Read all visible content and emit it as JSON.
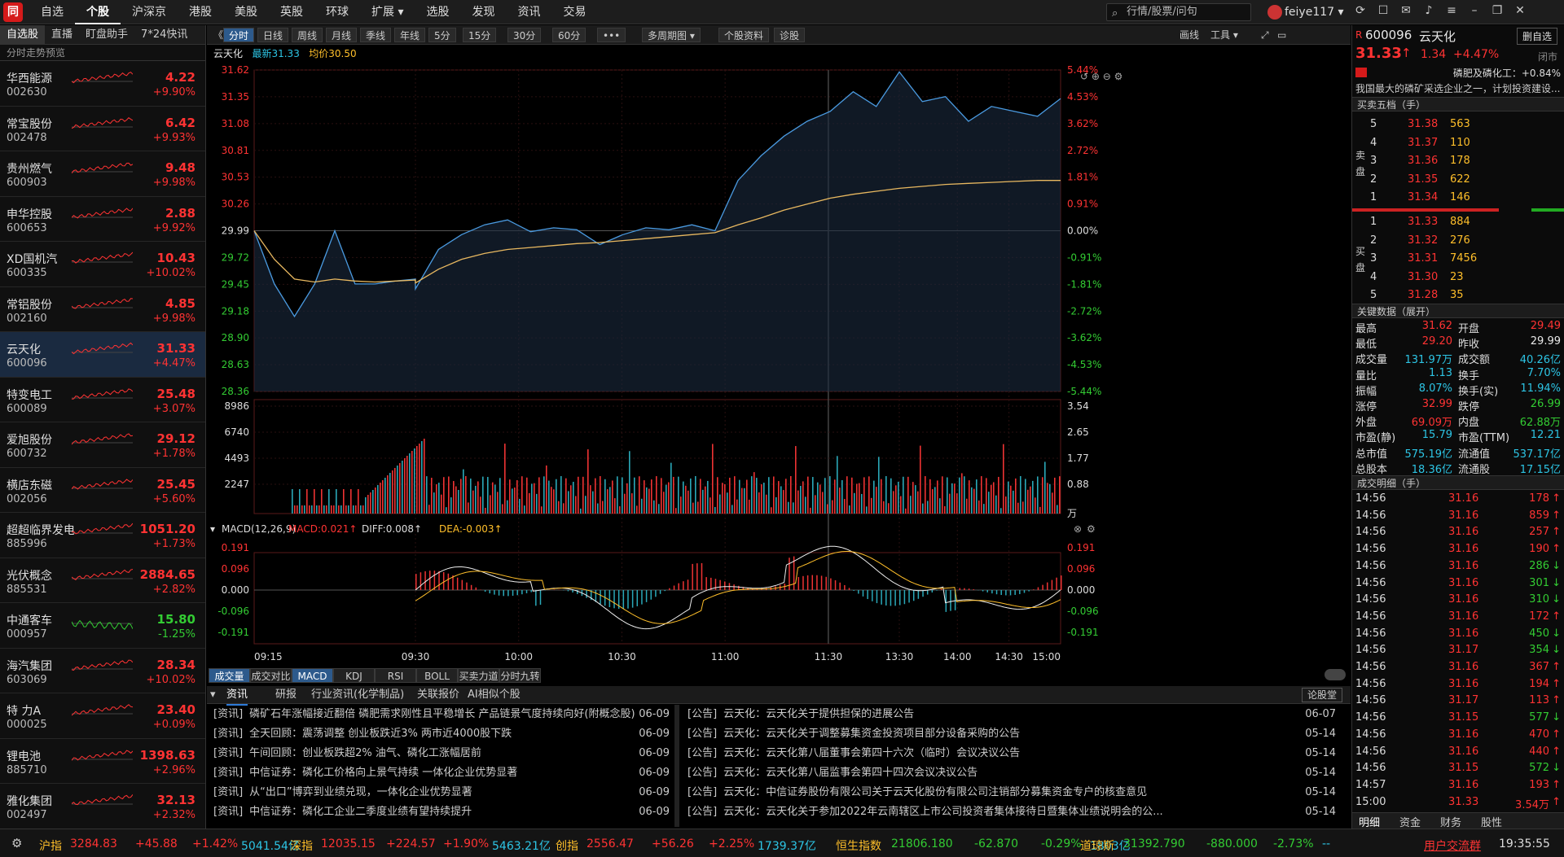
{
  "menu": [
    "自选",
    "个股",
    "沪深京",
    "港股",
    "美股",
    "英股",
    "环球",
    "扩展 ▾",
    "选股",
    "发现",
    "资讯",
    "交易"
  ],
  "search_placeholder": "行情/股票/问句",
  "user": "feiye117",
  "left_tabs": [
    "自选股",
    "直播",
    "盯盘助手",
    "7*24快讯"
  ],
  "left_sub": "分时走势预览",
  "stocks": [
    {
      "name": "华西能源",
      "code": "002630",
      "price": "4.22",
      "chg": "+9.90%",
      "up": true
    },
    {
      "name": "常宝股份",
      "code": "002478",
      "price": "6.42",
      "chg": "+9.93%",
      "up": true
    },
    {
      "name": "贵州燃气",
      "code": "600903",
      "price": "9.48",
      "chg": "+9.98%",
      "up": true
    },
    {
      "name": "申华控股",
      "code": "600653",
      "price": "2.88",
      "chg": "+9.92%",
      "up": true
    },
    {
      "name": "XD国机汽",
      "code": "600335",
      "price": "10.43",
      "chg": "+10.02%",
      "up": true
    },
    {
      "name": "常铝股份",
      "code": "002160",
      "price": "4.85",
      "chg": "+9.98%",
      "up": true
    },
    {
      "name": "云天化",
      "code": "600096",
      "price": "31.33",
      "chg": "+4.47%",
      "up": true
    },
    {
      "name": "特变电工",
      "code": "600089",
      "price": "25.48",
      "chg": "+3.07%",
      "up": true
    },
    {
      "name": "爱旭股份",
      "code": "600732",
      "price": "29.12",
      "chg": "+1.78%",
      "up": true
    },
    {
      "name": "横店东磁",
      "code": "002056",
      "price": "25.45",
      "chg": "+5.60%",
      "up": true
    },
    {
      "name": "超超临界发电",
      "code": "885996",
      "price": "1051.20",
      "chg": "+1.73%",
      "up": true
    },
    {
      "name": "光伏概念",
      "code": "885531",
      "price": "2884.65",
      "chg": "+2.82%",
      "up": true
    },
    {
      "name": "中通客车",
      "code": "000957",
      "price": "15.80",
      "chg": "-1.25%",
      "up": false
    },
    {
      "name": "海汽集团",
      "code": "603069",
      "price": "28.34",
      "chg": "+10.02%",
      "up": true
    },
    {
      "name": "特 力A",
      "code": "000025",
      "price": "23.40",
      "chg": "+0.09%",
      "up": true
    },
    {
      "name": "锂电池",
      "code": "885710",
      "price": "1398.63",
      "chg": "+2.96%",
      "up": true
    },
    {
      "name": "雅化集团",
      "code": "002497",
      "price": "32.13",
      "chg": "+2.32%",
      "up": true
    }
  ],
  "toolbar": {
    "items": [
      "分时",
      "日线",
      "周线",
      "月线",
      "季线",
      "年线",
      "5分",
      "15分",
      "30分",
      "60分",
      "•••",
      "多周期图 ▾",
      "个股资料",
      "诊股"
    ],
    "right": [
      "画线",
      "工具 ▾"
    ]
  },
  "info": {
    "name": "云天化",
    "latest": "最新31.33",
    "avg": "均价30.50"
  },
  "chart_data": [
    {
      "type": "line",
      "title": "分时",
      "series": [
        {
          "name": "最新",
          "color": "#4a9ae0",
          "values": [
            29.99,
            29.45,
            29.12,
            29.45,
            29.99,
            29.45,
            29.45,
            29.48,
            29.5,
            29.4,
            29.8,
            29.95,
            30.05,
            30.1,
            29.98,
            30.02,
            30.0,
            29.85,
            29.95,
            30.02,
            30.0,
            30.05,
            29.99,
            30.5,
            30.75,
            30.95,
            31.1,
            31.2,
            31.4,
            31.25,
            31.6,
            31.3,
            31.35,
            31.1,
            31.25,
            31.2,
            31.15,
            31.33
          ]
        },
        {
          "name": "均价",
          "color": "#e8b860",
          "values": [
            29.99,
            29.7,
            29.5,
            29.47,
            29.5,
            29.48,
            29.47,
            29.48,
            29.49,
            29.46,
            29.6,
            29.7,
            29.76,
            29.8,
            29.82,
            29.84,
            29.86,
            29.87,
            29.89,
            29.91,
            29.93,
            29.95,
            29.97,
            30.05,
            30.12,
            30.2,
            30.26,
            30.32,
            30.36,
            30.39,
            30.42,
            30.44,
            30.46,
            30.47,
            30.48,
            30.49,
            30.5,
            30.5
          ]
        }
      ],
      "ylim": [
        28.36,
        31.62
      ],
      "prev_close": 29.99,
      "y_ticks": [
        "31.62",
        "31.35",
        "31.08",
        "30.81",
        "30.53",
        "30.26",
        "29.99",
        "29.72",
        "29.45",
        "29.18",
        "28.90",
        "28.63",
        "28.36"
      ],
      "pct_ticks": [
        "5.44%",
        "4.53%",
        "3.62%",
        "2.72%",
        "1.81%",
        "0.91%",
        "0.00%",
        "-0.91%",
        "-1.81%",
        "-2.72%",
        "-3.62%",
        "-4.53%",
        "-5.44%"
      ]
    },
    {
      "type": "bar",
      "title": "成交量",
      "y_ticks": [
        "8986",
        "6740",
        "4493",
        "2247"
      ],
      "right_ticks": [
        "3.54",
        "2.65",
        "1.77",
        "0.88"
      ],
      "unit": "万"
    },
    {
      "type": "bar",
      "title": "MACD(12,26,9)",
      "labels": {
        "macd": "MACD:0.021",
        "diff": "DIFF:0.008",
        "dea": "DEA:-0.003"
      },
      "y_ticks": [
        "0.191",
        "0.096",
        "0.000",
        "-0.096",
        "-0.191"
      ]
    }
  ],
  "x_ticks": [
    "09:15",
    "09:30",
    "10:00",
    "10:30",
    "11:00",
    "11:30",
    "13:30",
    "14:00",
    "14:30",
    "15:00"
  ],
  "indicator_tabs": [
    "成交量",
    "成交对比",
    "MACD",
    "KDJ",
    "RSI",
    "BOLL",
    "买卖力道",
    "分时九转"
  ],
  "news_tabs": [
    "资讯",
    "研报",
    "行业资讯(化学制品)",
    "关联报价",
    "AI相似个股"
  ],
  "news_btn": "论股堂",
  "news_left": [
    {
      "tag": "[资讯]",
      "text": "磷矿石年涨幅接近翻倍 磷肥需求刚性且平稳增长 产品链景气度持续向好(附概念股)",
      "date": "06-09"
    },
    {
      "tag": "[资讯]",
      "text": "全天回顾：震荡调整 创业板跌近3% 两市近4000股下跌",
      "date": "06-09"
    },
    {
      "tag": "[资讯]",
      "text": "午间回顾：创业板跌超2% 油气、磷化工涨幅居前",
      "date": "06-09"
    },
    {
      "tag": "[资讯]",
      "text": "中信证券：磷化工价格向上景气持续 一体化企业优势显著",
      "date": "06-09"
    },
    {
      "tag": "[资讯]",
      "text": "从“出口”博弈到业绩兑现，一体化企业优势显著",
      "date": "06-09"
    },
    {
      "tag": "[资讯]",
      "text": "中信证券：磷化工企业二季度业绩有望持续提升",
      "date": "06-09"
    }
  ],
  "news_right": [
    {
      "tag": "[公告]",
      "text": "云天化：云天化关于提供担保的进展公告",
      "date": "06-07"
    },
    {
      "tag": "[公告]",
      "text": "云天化：云天化关于调整募集资金投资项目部分设备采购的公告",
      "date": "05-14"
    },
    {
      "tag": "[公告]",
      "text": "云天化：云天化第八届董事会第四十六次（临时）会议决议公告",
      "date": "05-14"
    },
    {
      "tag": "[公告]",
      "text": "云天化：云天化第八届监事会第四十四次会议决议公告",
      "date": "05-14"
    },
    {
      "tag": "[公告]",
      "text": "云天化：中信证券股份有限公司关于云天化股份有限公司注销部分募集资金专户的核查意见",
      "date": "05-14"
    },
    {
      "tag": "[公告]",
      "text": "云天化：云天化关于参加2022年云南辖区上市公司投资者集体接待日暨集体业绩说明会的公...",
      "date": "05-14"
    }
  ],
  "right": {
    "btn": "删自选",
    "code": "600096",
    "name": "云天化",
    "price": "31.33",
    "chg": "1.34",
    "pct": "+4.47%",
    "state": "闭市",
    "sector": "磷肥及磷化工：+0.84%",
    "desc": "我国最大的磷矿采选企业之一，计划投资建设...",
    "ob_title": "买卖五档（手）",
    "asks": [
      [
        "5",
        "31.38",
        "563"
      ],
      [
        "4",
        "31.37",
        "110"
      ],
      [
        "3",
        "31.36",
        "178"
      ],
      [
        "2",
        "31.35",
        "622"
      ],
      [
        "1",
        "31.34",
        "146"
      ]
    ],
    "bids": [
      [
        "1",
        "31.33",
        "884"
      ],
      [
        "2",
        "31.32",
        "276"
      ],
      [
        "3",
        "31.31",
        "7456"
      ],
      [
        "4",
        "31.30",
        "23"
      ],
      [
        "5",
        "31.28",
        "35"
      ]
    ],
    "ask_label": "卖盘",
    "bid_label": "买盘",
    "key_title": "关键数据（展开）",
    "key": [
      [
        "最高",
        "31.62",
        "red",
        "开盘",
        "29.49",
        "red"
      ],
      [
        "最低",
        "29.20",
        "red",
        "昨收",
        "29.99",
        "white"
      ],
      [
        "成交量",
        "131.97万",
        "cyan",
        "成交额",
        "40.26亿",
        "cyan"
      ],
      [
        "量比",
        "1.13",
        "cyan",
        "换手",
        "7.70%",
        "cyan"
      ],
      [
        "振幅",
        "8.07%",
        "cyan",
        "换手(实)",
        "11.94%",
        "cyan"
      ],
      [
        "涨停",
        "32.99",
        "red",
        "跌停",
        "26.99",
        "green"
      ],
      [
        "外盘",
        "69.09万",
        "red",
        "内盘",
        "62.88万",
        "green"
      ],
      [
        "市盈(静)",
        "15.79",
        "cyan",
        "市盈(TTM)",
        "12.21",
        "cyan"
      ],
      [
        "总市值",
        "575.19亿",
        "cyan",
        "流通值",
        "537.17亿",
        "cyan"
      ],
      [
        "总股本",
        "18.36亿",
        "cyan",
        "流通股",
        "17.15亿",
        "cyan"
      ]
    ],
    "trade_title": "成交明细（手）",
    "trades": [
      [
        "14:56",
        "31.16",
        "178"
      ],
      [
        "14:56",
        "31.16",
        "859"
      ],
      [
        "14:56",
        "31.16",
        "257"
      ],
      [
        "14:56",
        "31.16",
        "190"
      ],
      [
        "14:56",
        "31.16",
        "286"
      ],
      [
        "14:56",
        "31.16",
        "301"
      ],
      [
        "14:56",
        "31.16",
        "310"
      ],
      [
        "14:56",
        "31.16",
        "172"
      ],
      [
        "14:56",
        "31.16",
        "450"
      ],
      [
        "14:56",
        "31.17",
        "354"
      ],
      [
        "14:56",
        "31.16",
        "367"
      ],
      [
        "14:56",
        "31.16",
        "194"
      ],
      [
        "14:56",
        "31.17",
        "113"
      ],
      [
        "14:56",
        "31.15",
        "577"
      ],
      [
        "14:56",
        "31.16",
        "470"
      ],
      [
        "14:56",
        "31.16",
        "440"
      ],
      [
        "14:56",
        "31.15",
        "572"
      ],
      [
        "14:57",
        "31.16",
        "193"
      ],
      [
        "15:00",
        "31.33",
        "3.54万"
      ]
    ],
    "trade_colors": [
      "red",
      "red",
      "red",
      "red",
      "green",
      "green",
      "green",
      "red",
      "green",
      "green",
      "red",
      "red",
      "red",
      "green",
      "red",
      "red",
      "green",
      "red",
      "red"
    ],
    "bottom_tabs": [
      "明细",
      "资金",
      "财务",
      "股性"
    ]
  },
  "status": [
    {
      "name": "沪指",
      "v": "3284.83",
      "c": "+45.88",
      "p": "+1.42%",
      "a": "5041.54亿"
    },
    {
      "name": "深指",
      "v": "12035.15",
      "c": "+224.57",
      "p": "+1.90%",
      "a": "5463.21亿"
    },
    {
      "name": "创指",
      "v": "2556.47",
      "c": "+56.26",
      "p": "+2.25%",
      "a": "1739.37亿"
    },
    {
      "name": "恒生指数",
      "v": "21806.180",
      "c": "-62.870",
      "p": "-0.29%",
      "a": "1803亿"
    },
    {
      "name": "道琼斯",
      "v": "31392.790",
      "c": "-880.000",
      "p": "-2.73%",
      "a": "--"
    }
  ],
  "status_right": "用户交流群",
  "clock": "19:35:55"
}
